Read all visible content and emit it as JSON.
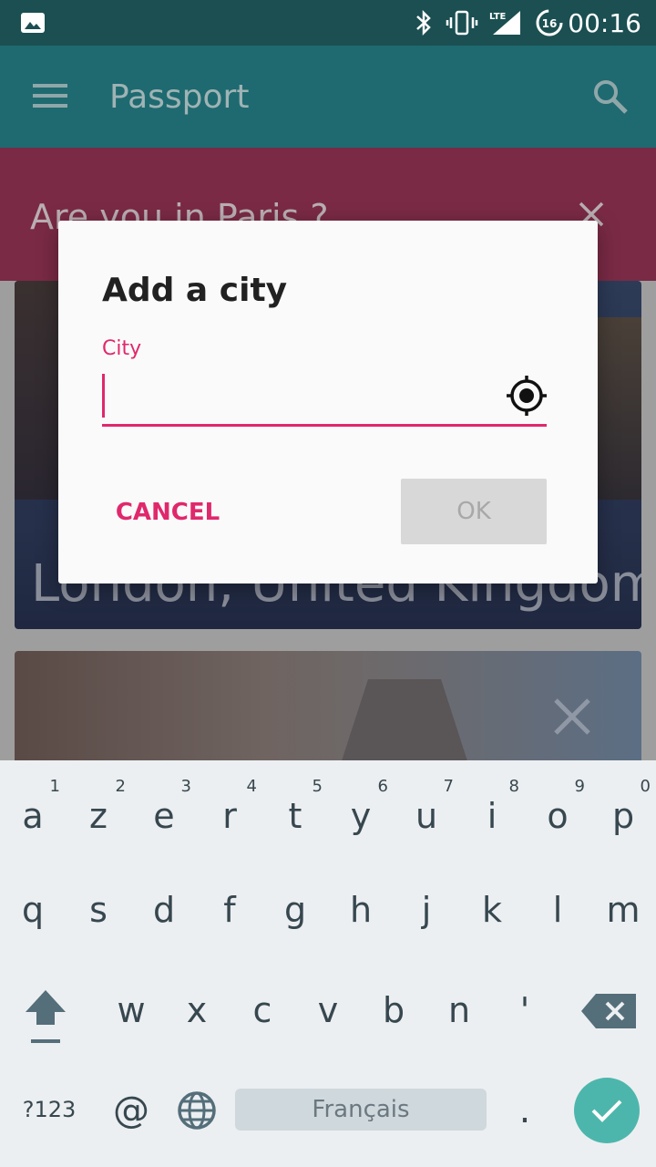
{
  "status_bar": {
    "time": "00:16",
    "battery_level": "16",
    "network": "LTE",
    "icons": [
      "gallery-notification-icon",
      "bluetooth-icon",
      "vibrate-icon",
      "lte-signal-icon",
      "battery-saver-icon"
    ]
  },
  "app_bar": {
    "title": "Passport",
    "icons": [
      "menu-icon",
      "search-icon"
    ]
  },
  "banner": {
    "text": "Are you in Paris ?",
    "close_icon": "close-icon"
  },
  "cards": [
    {
      "title": "London, United Kingdom"
    },
    {
      "title": ""
    }
  ],
  "dialog": {
    "title": "Add a city",
    "field_label": "City",
    "field_value": "",
    "location_icon": "my-location-icon",
    "cancel_label": "CANCEL",
    "ok_label": "OK"
  },
  "keyboard": {
    "row1": [
      {
        "ch": "a",
        "hint": "1"
      },
      {
        "ch": "z",
        "hint": "2"
      },
      {
        "ch": "e",
        "hint": "3"
      },
      {
        "ch": "r",
        "hint": "4"
      },
      {
        "ch": "t",
        "hint": "5"
      },
      {
        "ch": "y",
        "hint": "6"
      },
      {
        "ch": "u",
        "hint": "7"
      },
      {
        "ch": "i",
        "hint": "8"
      },
      {
        "ch": "o",
        "hint": "9"
      },
      {
        "ch": "p",
        "hint": "0"
      }
    ],
    "row2": [
      "q",
      "s",
      "d",
      "f",
      "g",
      "h",
      "j",
      "k",
      "l",
      "m"
    ],
    "row3": [
      "w",
      "x",
      "c",
      "v",
      "b",
      "n",
      "'"
    ],
    "symbols_label": "?123",
    "at_label": "@",
    "space_label": "Français",
    "period_label": ".",
    "accent_color": "#4db6ac"
  },
  "colors": {
    "primary": "#1e6a70",
    "accent": "#e0286c",
    "banner": "#7a2a45"
  }
}
